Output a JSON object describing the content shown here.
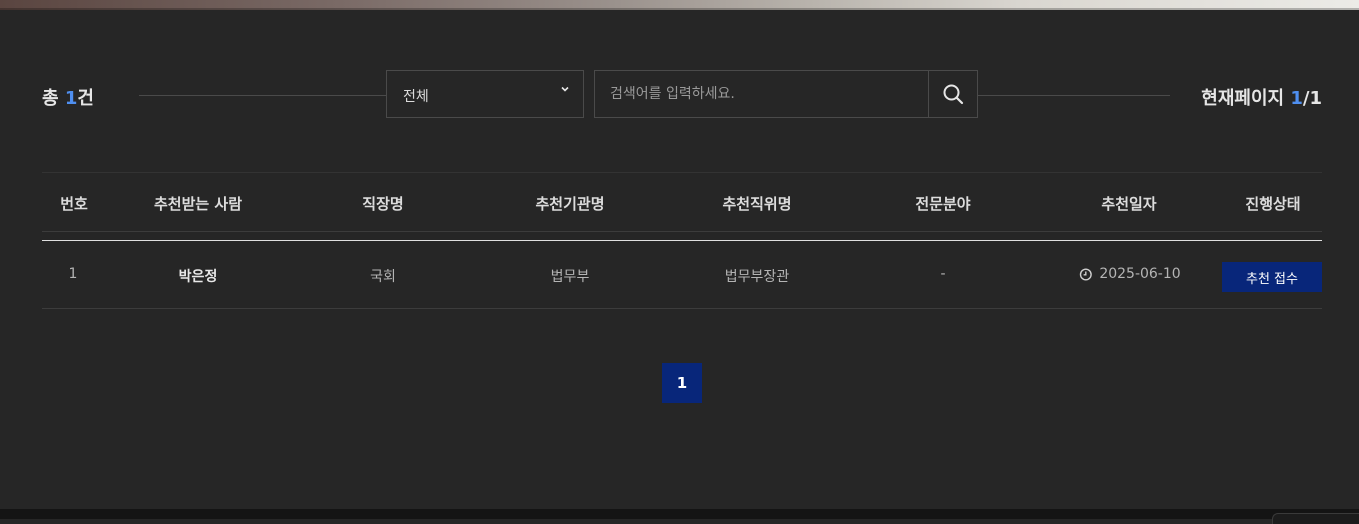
{
  "colors": {
    "accent": "#4f8ff0",
    "status_bg": "#08267a",
    "background": "#262626"
  },
  "summary": {
    "total_prefix": "총 ",
    "total_count": "1",
    "total_suffix": "건",
    "page_label": "현재페이지 ",
    "current_page": "1",
    "page_total": "/1"
  },
  "filter": {
    "selected": "전체"
  },
  "search": {
    "placeholder": "검색어를 입력하세요.",
    "value": ""
  },
  "table": {
    "headers": {
      "no": "번호",
      "person": "추천받는 사람",
      "workplace": "직장명",
      "org": "추천기관명",
      "position": "추천직위명",
      "field": "전문분야",
      "date": "추천일자",
      "status": "진행상태"
    },
    "rows": [
      {
        "no": "1",
        "person": "박은정",
        "workplace": "국회",
        "org": "법무부",
        "position": "법무부장관",
        "field": "-",
        "date": "2025-06-10",
        "status": "추천 접수"
      }
    ]
  },
  "pagination": {
    "pages": [
      "1"
    ],
    "active": "1"
  },
  "icons": {
    "select": "chevron-down-icon",
    "search": "search-icon",
    "date": "clock-icon"
  }
}
